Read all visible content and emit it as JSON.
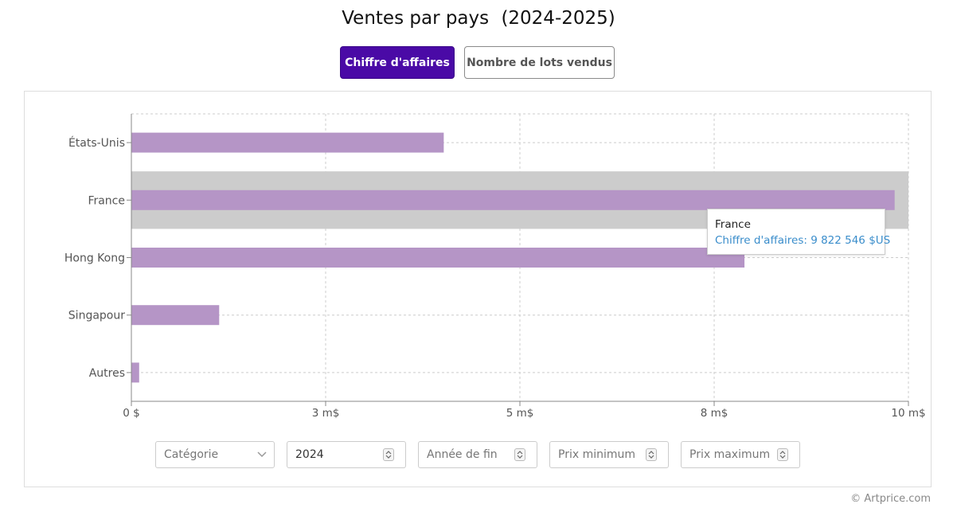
{
  "header": {
    "title": "Ventes par pays",
    "period": "(2024-2025)"
  },
  "tabs": [
    {
      "label": "Chiffre d'affaires",
      "active": true
    },
    {
      "label": "Nombre de lots vendus",
      "active": false
    }
  ],
  "chart_data": {
    "type": "bar",
    "orientation": "horizontal",
    "categories": [
      "États-Unis",
      "France",
      "Hong Kong",
      "Singapour",
      "Autres"
    ],
    "values": [
      4020000,
      9822546,
      7890000,
      1130000,
      100000
    ],
    "xlim": [
      0,
      10000000
    ],
    "x_ticks": [
      0,
      2500000,
      5000000,
      7500000,
      10000000
    ],
    "x_tick_labels": [
      "0 $",
      "3 m$",
      "5 m$",
      "8 m$",
      "10 m$"
    ],
    "bar_color": "#b595c6",
    "highlight_color": "#cccccc",
    "highlighted_category": "France",
    "grid": true
  },
  "tooltip": {
    "title": "France",
    "value": "Chiffre d'affaires: 9 822 546 $US"
  },
  "filters": {
    "category_placeholder": "Catégorie",
    "start_year": "2024",
    "end_year_placeholder": "Année de fin",
    "min_price_placeholder": "Prix minimum",
    "max_price_placeholder": "Prix maximum"
  },
  "footer": {
    "copyright": "© Artprice.com"
  }
}
